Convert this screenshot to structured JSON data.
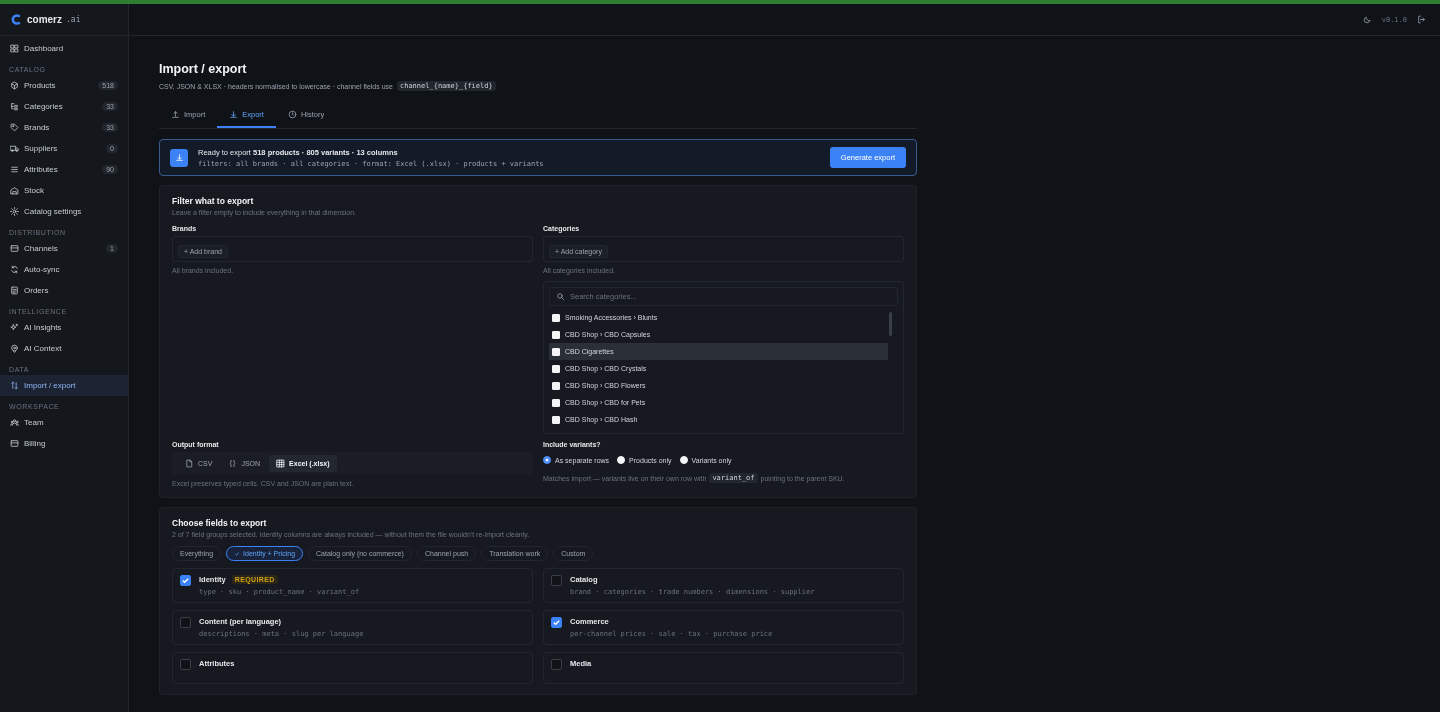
{
  "brand": {
    "name": "comerz",
    "suffix": ".ai"
  },
  "topbar": {
    "version": "v0.1.0"
  },
  "sidebar": {
    "items": [
      {
        "kind": "item",
        "label": "Dashboard",
        "selected": false
      },
      {
        "kind": "section",
        "label": "CATALOG"
      },
      {
        "kind": "item",
        "label": "Products",
        "count": "518",
        "selected": false
      },
      {
        "kind": "item",
        "label": "Categories",
        "count": "33",
        "selected": false
      },
      {
        "kind": "item",
        "label": "Brands",
        "count": "33",
        "selected": false
      },
      {
        "kind": "item",
        "label": "Suppliers",
        "count": "0",
        "selected": false
      },
      {
        "kind": "item",
        "label": "Attributes",
        "count": "90",
        "selected": false
      },
      {
        "kind": "item",
        "label": "Stock",
        "selected": false
      },
      {
        "kind": "item",
        "label": "Catalog settings",
        "selected": false
      },
      {
        "kind": "section",
        "label": "DISTRIBUTION"
      },
      {
        "kind": "item",
        "label": "Channels",
        "count": "1",
        "selected": false
      },
      {
        "kind": "item",
        "label": "Auto-sync",
        "selected": false
      },
      {
        "kind": "item",
        "label": "Orders",
        "selected": false
      },
      {
        "kind": "section",
        "label": "INTELLIGENCE"
      },
      {
        "kind": "item",
        "label": "AI Insights",
        "selected": false
      },
      {
        "kind": "item",
        "label": "AI Context",
        "selected": false
      },
      {
        "kind": "section",
        "label": "DATA"
      },
      {
        "kind": "item",
        "label": "Import / export",
        "selected": true
      },
      {
        "kind": "section",
        "label": "WORKSPACE"
      },
      {
        "kind": "item",
        "label": "Team",
        "selected": false
      },
      {
        "kind": "item",
        "label": "Billing",
        "selected": false
      }
    ]
  },
  "page": {
    "title": "Import / export",
    "subtitle": "CSV, JSON & XLSX · headers normalised to lowercase · channel fields use",
    "subtitle_code": "channel_{name}_{field}"
  },
  "tabs": [
    {
      "label": "Import",
      "selected": false
    },
    {
      "label": "Export",
      "selected": true
    },
    {
      "label": "History",
      "selected": false
    }
  ],
  "summary": {
    "text": "Ready to export **518 products · 805 variants · 13 columns**",
    "details": "filters: all brands · all categories · format: Excel (.xlsx) · products + variants",
    "button": "Generate export"
  },
  "filter": {
    "title": "Filter what to export",
    "hint": "Leave a filter empty to include everything in that dimension.",
    "brands": {
      "label": "Brands",
      "add": "+ Add brand",
      "note": "All brands included."
    },
    "categories": {
      "label": "Categories",
      "add": "+ Add category",
      "note": "All categories included.",
      "search_placeholder": "Search categories...",
      "options": [
        {
          "label": "Smoking Accessories › Blunts",
          "checked": false,
          "hovered": false
        },
        {
          "label": "CBD Shop › CBD Capsules",
          "checked": false,
          "hovered": false
        },
        {
          "label": "CBD Cigarettes",
          "checked": false,
          "hovered": true
        },
        {
          "label": "CBD Shop › CBD Crystals",
          "checked": false,
          "hovered": false
        },
        {
          "label": "CBD Shop › CBD Flowers",
          "checked": false,
          "hovered": false
        },
        {
          "label": "CBD Shop › CBD for Pets",
          "checked": false,
          "hovered": false
        },
        {
          "label": "CBD Shop › CBD Hash",
          "checked": false,
          "hovered": false
        }
      ]
    },
    "output": {
      "label": "Output format",
      "options": [
        {
          "label": "CSV",
          "selected": false
        },
        {
          "label": "JSON",
          "selected": false
        },
        {
          "label": "Excel (.xlsx)",
          "selected": true
        }
      ],
      "note": "Excel preserves typed cells. CSV and JSON are plain text."
    },
    "variants": {
      "label": "Include variants?",
      "options": [
        {
          "label": "As separate rows",
          "selected": true
        },
        {
          "label": "Products only",
          "selected": false
        },
        {
          "label": "Variants only",
          "selected": false
        }
      ],
      "note_before": "Matches import — variants live on their own row with",
      "note_code": "variant_of",
      "note_after": "pointing to the parent SKU."
    }
  },
  "fields": {
    "title": "Choose fields to export",
    "hint": "2 of 7 field groups selected. Identity columns are always included — without them the file wouldn't re-import cleanly.",
    "presets": [
      {
        "label": "Everything",
        "selected": false
      },
      {
        "label": "Identity + Pricing",
        "selected": true
      },
      {
        "label": "Catalog only (no commerce)",
        "selected": false
      },
      {
        "label": "Channel push",
        "selected": false
      },
      {
        "label": "Translation work",
        "selected": false
      },
      {
        "label": "Custom",
        "selected": false
      }
    ],
    "groups": [
      {
        "name": "Identity",
        "badge": "REQUIRED",
        "checked": true,
        "columns": "type · sku · product_name · variant_of"
      },
      {
        "name": "Catalog",
        "checked": false,
        "columns": "brand · categories · trade numbers · dimensions · supplier"
      },
      {
        "name": "Content (per language)",
        "checked": false,
        "columns": "descriptions · meta · slug per language"
      },
      {
        "name": "Commerce",
        "checked": true,
        "columns": "per-channel prices · sale · tax · purchase price"
      },
      {
        "name": "Attributes",
        "checked": false
      },
      {
        "name": "Media",
        "checked": false
      }
    ]
  }
}
